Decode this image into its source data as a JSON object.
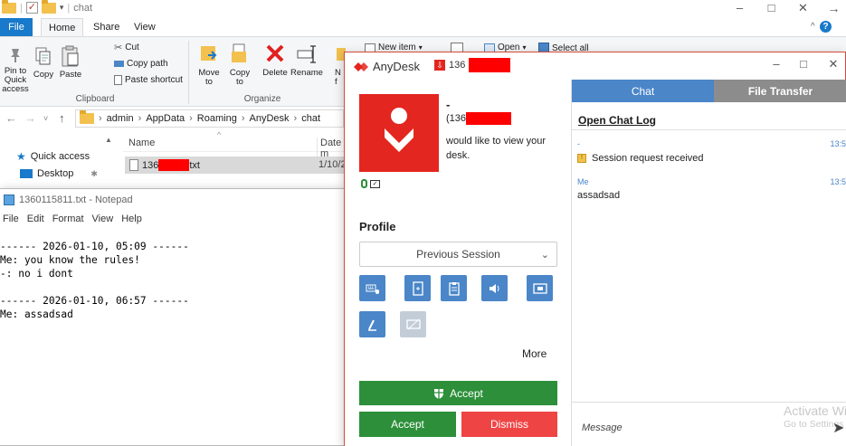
{
  "explorer": {
    "title": "chat",
    "tabs": [
      "File",
      "Home",
      "Share",
      "View"
    ],
    "clipboard": {
      "pin_label": "Pin to Quick access",
      "copy_label": "Copy",
      "paste_label": "Paste",
      "cut_label": "Cut",
      "copy_path_label": "Copy path",
      "paste_shortcut_label": "Paste shortcut",
      "group_label": "Clipboard"
    },
    "organize": {
      "move_label": "Move to",
      "copy_to_label": "Copy to",
      "delete_label": "Delete",
      "rename_label": "Rename",
      "group_label": "Organize"
    },
    "new": {
      "new_item_label": "New item",
      "partial_label": "N f"
    },
    "open": {
      "open_label": "Open",
      "select_all_label": "Select all"
    },
    "address": {
      "segments": [
        "admin",
        "AppData",
        "Roaming",
        "AnyDesk",
        "chat"
      ]
    },
    "nav": {
      "quick_access": "Quick access",
      "desktop": "Desktop"
    },
    "columns": {
      "name": "Name",
      "date": "Date m"
    },
    "file": {
      "name_prefix": "136",
      "name_suffix": "txt",
      "date": "1/10/2"
    }
  },
  "notepad": {
    "title": "1360115811.txt - Notepad",
    "menu": [
      "File",
      "Edit",
      "Format",
      "View",
      "Help"
    ],
    "content": "------ 2026-01-10, 05:09 ------\nMe: you know the rules!\n-: no i dont\n\n------ 2026-01-10, 06:57 ------\nMe: assadsad"
  },
  "anydesk": {
    "app_name": "AnyDesk",
    "id_prefix": "136",
    "requester_name": "-",
    "requester_id_prefix": "(136",
    "request_message": "would like to view your desk.",
    "profile_label": "Profile",
    "profile_value": "Previous Session",
    "more_label": "More",
    "accept_top_label": "Accept",
    "accept_label": "Accept",
    "dismiss_label": "Dismiss",
    "chat": {
      "tab_chat": "Chat",
      "tab_file_transfer": "File Transfer",
      "open_log_label": "Open Chat Log",
      "messages": [
        {
          "sender": "-",
          "time": "13:5",
          "text": "Session request received"
        },
        {
          "sender": "Me",
          "time": "13:5",
          "text": "assadsad"
        }
      ],
      "message_placeholder": "Message"
    },
    "colors": {
      "brand_red": "#e3261f",
      "accent_blue": "#4a86c8",
      "accept_green": "#2d8f3a",
      "dismiss_red": "#ef4444"
    }
  },
  "watermark": {
    "line1": "Activate Windows",
    "line2": "Go to Settings"
  }
}
